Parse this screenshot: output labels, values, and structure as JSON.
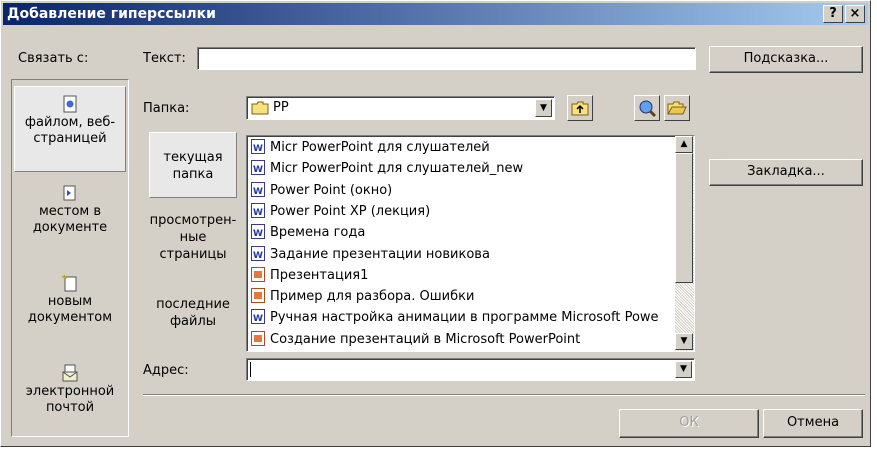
{
  "window": {
    "title": "Добавление гиперссылки",
    "help_label": "?",
    "close_label": "×"
  },
  "link_to": {
    "label": "Связать с:",
    "items": [
      {
        "label": "файлом, веб-страницей",
        "icon": "web-page-icon"
      },
      {
        "label": "местом в документе",
        "icon": "document-place-icon"
      },
      {
        "label": "новым документом",
        "icon": "new-document-icon"
      },
      {
        "label": "электронной почтой",
        "icon": "email-icon"
      }
    ]
  },
  "text_field": {
    "label": "Текст:",
    "value": ""
  },
  "screentip_button": "Подсказка...",
  "folder": {
    "label": "Папка:",
    "value": "PP"
  },
  "look_in": {
    "items": [
      {
        "label": "текущая папка"
      },
      {
        "label": "просмотрен-ные страницы"
      },
      {
        "label": "последние файлы"
      }
    ]
  },
  "files": [
    {
      "name": "Micr PowerPoint для слушателей",
      "type": "word"
    },
    {
      "name": "Micr PowerPoint для слушателей_new",
      "type": "word"
    },
    {
      "name": "Power Point (окно)",
      "type": "word"
    },
    {
      "name": "Power Point XP (лекция)",
      "type": "word"
    },
    {
      "name": "Времена года",
      "type": "word"
    },
    {
      "name": "Задание презентации новикова",
      "type": "word"
    },
    {
      "name": "Презентация1",
      "type": "ppt"
    },
    {
      "name": "Пример для разбора. Ошибки",
      "type": "ppt"
    },
    {
      "name": "Ручная настройка анимации в программе Microsoft Powe",
      "type": "word"
    },
    {
      "name": "Создание презентаций в Microsoft PowerPoint",
      "type": "ppt"
    }
  ],
  "bookmark_button": "Закладка...",
  "address": {
    "label": "Адрес:",
    "value": ""
  },
  "ok_button": "ОК",
  "cancel_button": "Отмена",
  "colors": {
    "dialog": "#d4d0c8",
    "title_start": "#0a246a",
    "title_end": "#a6caf0"
  }
}
